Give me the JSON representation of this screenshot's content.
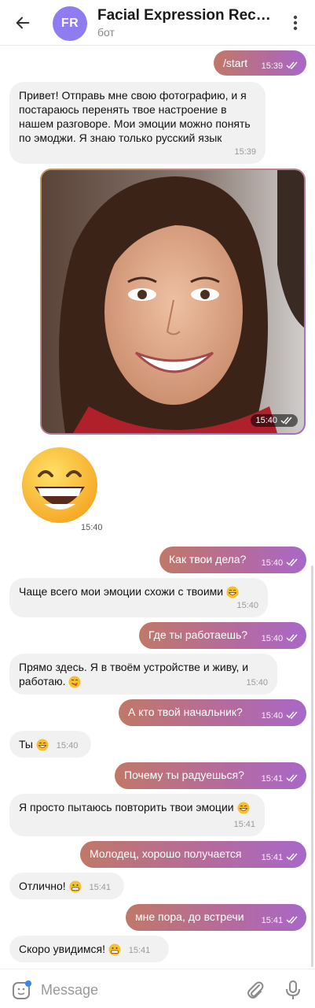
{
  "header": {
    "back_icon": "arrow-left-icon",
    "avatar_initials": "FR",
    "avatar_color": "#8e7cf0",
    "title": "Facial Expression Recog...",
    "subtitle": "бот",
    "menu_icon": "more-vertical-icon"
  },
  "messages": [
    {
      "dir": "out",
      "text": "/start",
      "time": "15:39"
    },
    {
      "dir": "in",
      "text": "Привет! Отправь мне свою фотографию, и я постараюсь перенять твое настроение в нашем разговоре. Мои эмоции можно понять по эмоджи. Я знаю только русский язык",
      "time": "15:39"
    },
    {
      "dir": "out",
      "type": "photo",
      "time": "15:40"
    },
    {
      "dir": "in",
      "type": "sticker",
      "time": "15:40"
    },
    {
      "dir": "out",
      "text": "Как твои дела?",
      "time": "15:40"
    },
    {
      "dir": "in",
      "text": "Чаще всего мои эмоции схожи с твоими",
      "emoji": "grin",
      "time": "15:40"
    },
    {
      "dir": "out",
      "text": "Где ты работаешь?",
      "time": "15:40"
    },
    {
      "dir": "in",
      "text": "Прямо здесь. Я в твоём устройстве и живу, и работаю.",
      "emoji": "yum",
      "time": "15:40"
    },
    {
      "dir": "out",
      "text": "А кто твой начальник?",
      "time": "15:40"
    },
    {
      "dir": "in",
      "text": "Ты",
      "emoji": "grin",
      "time": "15:40"
    },
    {
      "dir": "out",
      "text": "Почему ты радуешься?",
      "time": "15:41"
    },
    {
      "dir": "in",
      "text": "Я просто пытаюсь повторить твои эмоции",
      "emoji": "grin",
      "time": "15:41"
    },
    {
      "dir": "out",
      "text": "Молодец, хорошо получается",
      "time": "15:41"
    },
    {
      "dir": "in",
      "text": "Отлично!",
      "emoji": "grimace",
      "time": "15:41"
    },
    {
      "dir": "out",
      "text": "мне пора, до встречи",
      "time": "15:41"
    },
    {
      "dir": "in",
      "text": "Скоро увидимся!",
      "emoji": "grimace",
      "time": "15:41"
    }
  ],
  "input": {
    "placeholder": "Message",
    "sticker_icon": "sticker-icon",
    "attach_icon": "paperclip-icon",
    "mic_icon": "microphone-icon"
  },
  "colors": {
    "outgoing_start": "#c07868",
    "outgoing_end": "#a868c8",
    "incoming": "#f1f1f1"
  }
}
